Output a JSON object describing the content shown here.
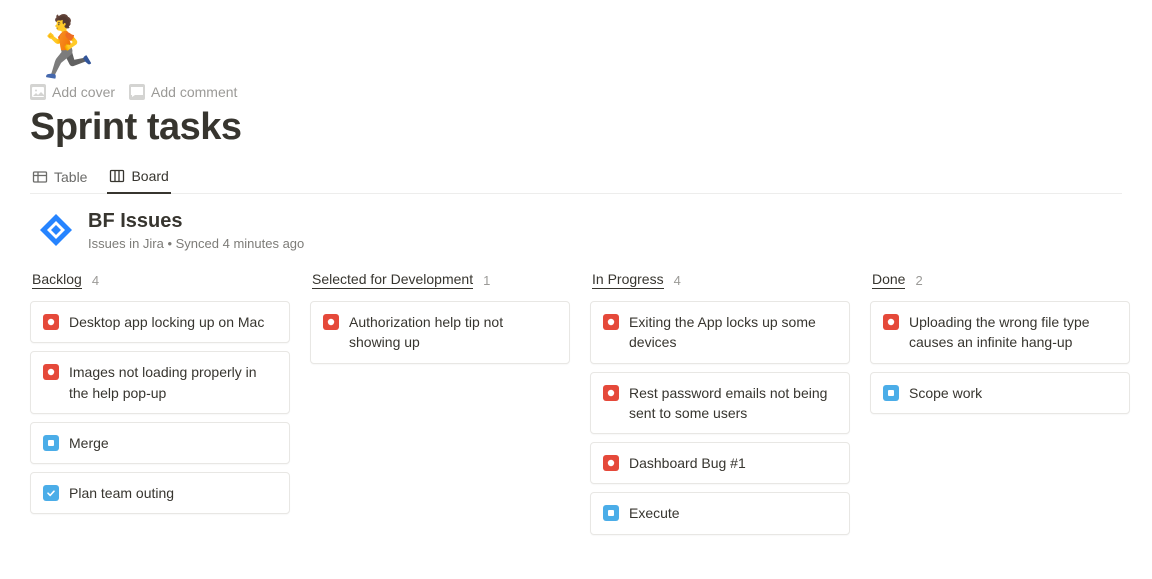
{
  "header": {
    "emoji": "🏃",
    "add_cover_label": "Add cover",
    "add_comment_label": "Add comment",
    "page_title": "Sprint tasks"
  },
  "views": {
    "table_label": "Table",
    "board_label": "Board",
    "active": "board"
  },
  "database": {
    "title": "BF Issues",
    "subtitle": "Issues in Jira  •  Synced 4 minutes ago"
  },
  "columns": [
    {
      "name": "Backlog",
      "count": "4",
      "cards": [
        {
          "icon": "bug",
          "title": "Desktop app locking up on Mac"
        },
        {
          "icon": "bug",
          "title": "Images not loading properly in the help pop-up"
        },
        {
          "icon": "task",
          "title": "Merge"
        },
        {
          "icon": "check",
          "title": "Plan team outing"
        }
      ]
    },
    {
      "name": "Selected for Development",
      "count": "1",
      "cards": [
        {
          "icon": "bug",
          "title": "Authorization help tip not showing up"
        }
      ]
    },
    {
      "name": "In Progress",
      "count": "4",
      "cards": [
        {
          "icon": "bug",
          "title": "Exiting the App locks up some devices"
        },
        {
          "icon": "bug",
          "title": "Rest password emails not being sent to some users"
        },
        {
          "icon": "bug",
          "title": "Dashboard Bug #1"
        },
        {
          "icon": "task",
          "title": "Execute"
        }
      ]
    },
    {
      "name": "Done",
      "count": "2",
      "cards": [
        {
          "icon": "bug",
          "title": "Uploading the wrong file type causes an infinite hang-up"
        },
        {
          "icon": "task",
          "title": "Scope work"
        }
      ]
    }
  ]
}
